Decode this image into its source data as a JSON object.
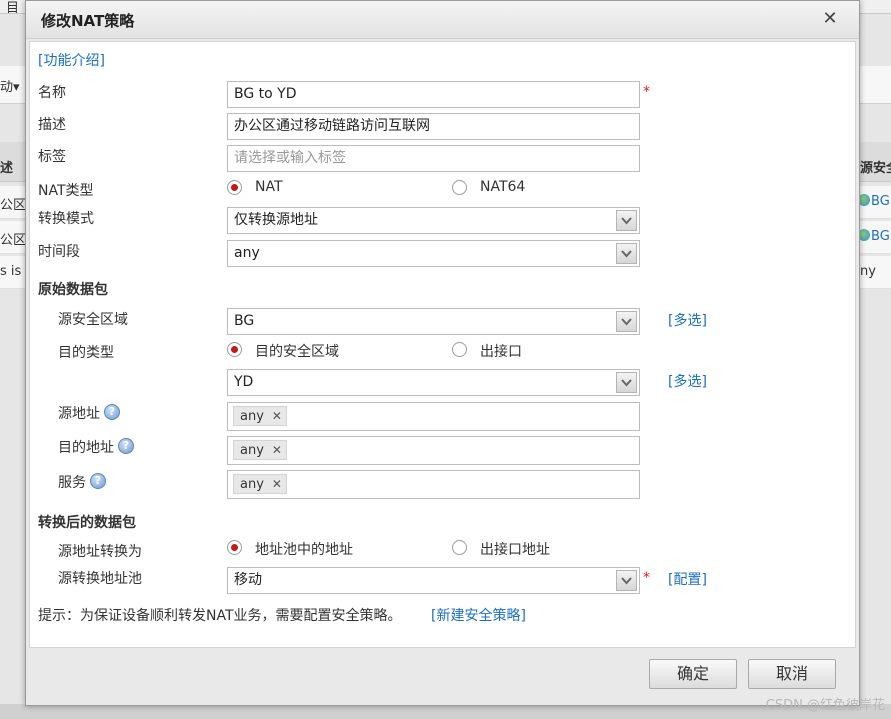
{
  "background": {
    "top_left_text": "目",
    "toolbar_text": "动▾",
    "header_left": "述",
    "header_right": "源安全",
    "rows": [
      {
        "left": "公区",
        "right": "BG"
      },
      {
        "left": "公区",
        "right": "BG"
      },
      {
        "left": "s is",
        "right": "ny"
      }
    ]
  },
  "dialog": {
    "title": "修改NAT策略",
    "close_icon": "close-icon"
  },
  "form": {
    "intro_link": "[功能介绍]",
    "name_label": "名称",
    "name_value": "BG to YD",
    "required_mark": "*",
    "desc_label": "描述",
    "desc_value": "办公区通过移动链路访问互联网",
    "tag_label": "标签",
    "tag_placeholder": "请选择或输入标签",
    "nat_type_label": "NAT类型",
    "nat_type_options": [
      "NAT",
      "NAT64"
    ],
    "nat_type_selected": "NAT",
    "convert_mode_label": "转换模式",
    "convert_mode_value": "仅转换源地址",
    "time_label": "时间段",
    "time_value": "any",
    "original_section": "原始数据包",
    "src_zone_label": "源安全区域",
    "src_zone_value": "BG",
    "multi_select_link": "[多选]",
    "dst_type_label": "目的类型",
    "dst_type_options": [
      "目的安全区域",
      "出接口"
    ],
    "dst_type_selected": "目的安全区域",
    "dst_zone_value": "YD",
    "src_addr_label": "源地址",
    "src_addr_tag": "any",
    "dst_addr_label": "目的地址",
    "dst_addr_tag": "any",
    "service_label": "服务",
    "service_tag": "any",
    "help_glyph": "?",
    "tag_remove_glyph": "✕",
    "translated_section": "转换后的数据包",
    "src_translate_label": "源地址转换为",
    "src_translate_options": [
      "地址池中的地址",
      "出接口地址"
    ],
    "src_translate_selected": "地址池中的地址",
    "src_pool_label": "源转换地址池",
    "src_pool_value": "移动",
    "config_link": "[配置]",
    "hint_text": "提示：为保证设备顺利转发NAT业务，需要配置安全策略。",
    "hint_link": "[新建安全策略]"
  },
  "buttons": {
    "ok": "确定",
    "cancel": "取消"
  },
  "watermark": "CSDN @红色彼岸花"
}
